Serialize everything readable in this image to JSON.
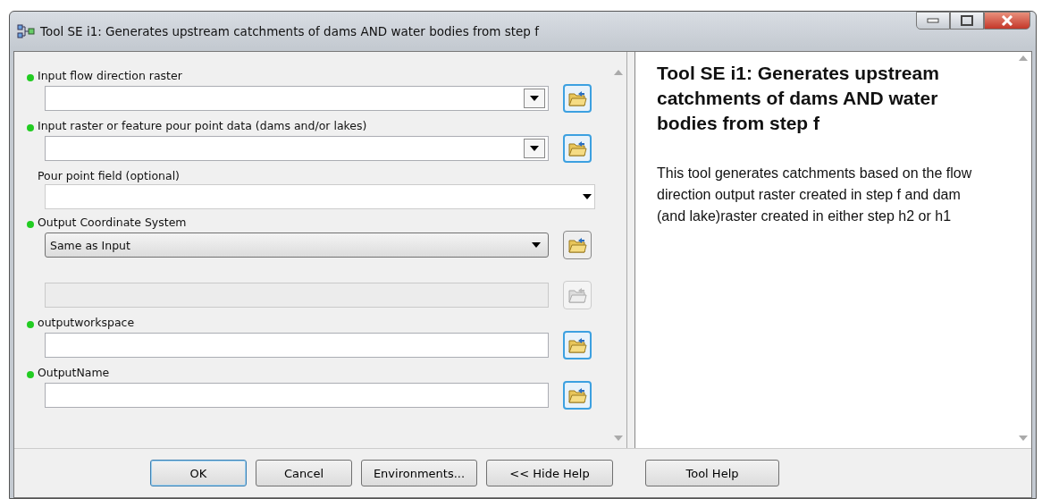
{
  "window": {
    "title": "Tool SE i1: Generates upstream catchments of dams AND water bodies from step f"
  },
  "parameters": [
    {
      "label": "Input flow direction raster",
      "required": true,
      "kind": "combo",
      "browse": {
        "disabled": false
      }
    },
    {
      "label": "Input raster or feature pour point data (dams and/or lakes)",
      "required": true,
      "kind": "combo",
      "browse": {
        "disabled": false
      }
    },
    {
      "label": "Pour point field (optional)",
      "required": false,
      "kind": "list"
    },
    {
      "label": "Output Coordinate System",
      "required": true,
      "kind": "select",
      "value": "Same as Input",
      "browse": {
        "disabled": false
      }
    },
    {
      "required": false,
      "kind": "text",
      "disabled": true,
      "browse": {
        "disabled": true
      }
    },
    {
      "label": "outputworkspace",
      "required": true,
      "kind": "text",
      "disabled": false,
      "browse": {
        "disabled": false
      }
    },
    {
      "label": "OutputName",
      "required": true,
      "kind": "text",
      "disabled": false,
      "browse": {
        "disabled": false
      }
    }
  ],
  "help": {
    "title": "Tool SE i1: Generates upstream catchments of dams AND water bodies from step f",
    "body": "This tool generates catchments based on the flow direction output raster created in step f and dam (and lake)raster created in either step h2 or h1"
  },
  "buttons": [
    {
      "label": "OK",
      "default": true
    },
    {
      "label": "Cancel",
      "default": false
    },
    {
      "label": "Environments...",
      "default": false
    },
    {
      "label": "<< Hide Help",
      "default": false
    }
  ],
  "help_button": {
    "label": "Tool Help"
  }
}
